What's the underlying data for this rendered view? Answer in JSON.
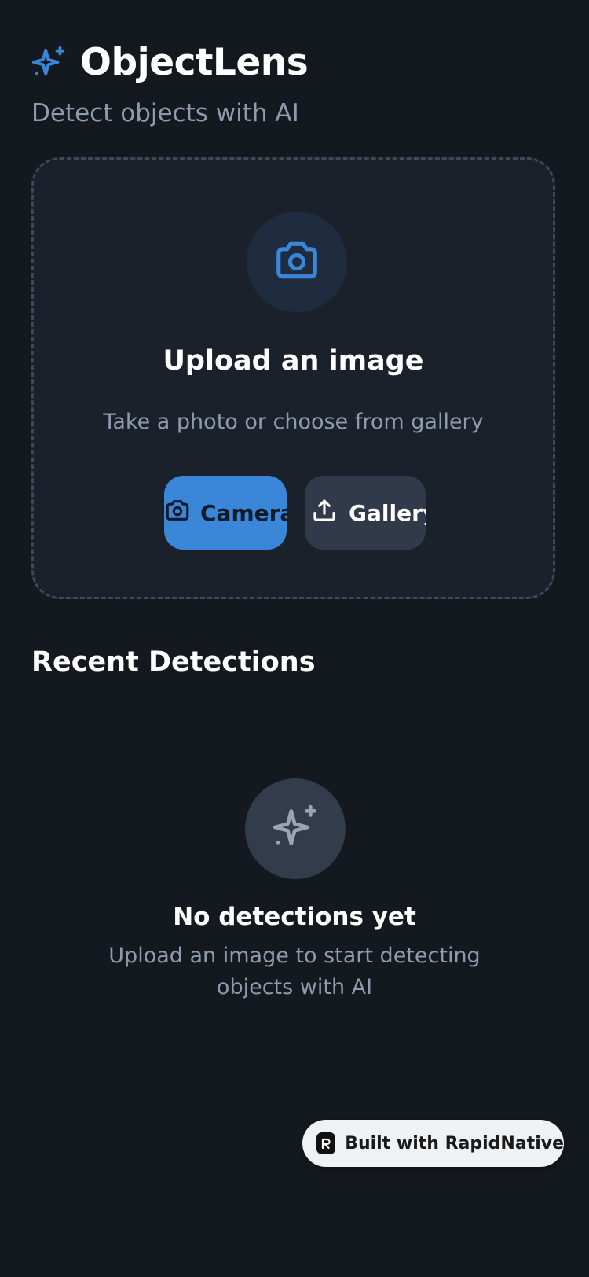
{
  "app": {
    "title": "ObjectLens",
    "subtitle": "Detect objects with AI",
    "logo_icon": "sparkles-icon",
    "accent_color": "#3a86d8"
  },
  "upload": {
    "icon": "camera-icon",
    "title": "Upload an image",
    "subtitle": "Take a photo or choose from gallery",
    "camera_button": {
      "label": "Camera",
      "icon": "camera-icon"
    },
    "gallery_button": {
      "label": "Gallery",
      "icon": "upload-icon"
    }
  },
  "recent": {
    "title": "Recent Detections",
    "empty_icon": "sparkles-icon",
    "empty_title": "No detections yet",
    "empty_subtitle": "Upload an image to start detecting objects with AI"
  },
  "badge": {
    "label": "Built with RapidNative",
    "icon": "rapidnative-logo-icon"
  }
}
